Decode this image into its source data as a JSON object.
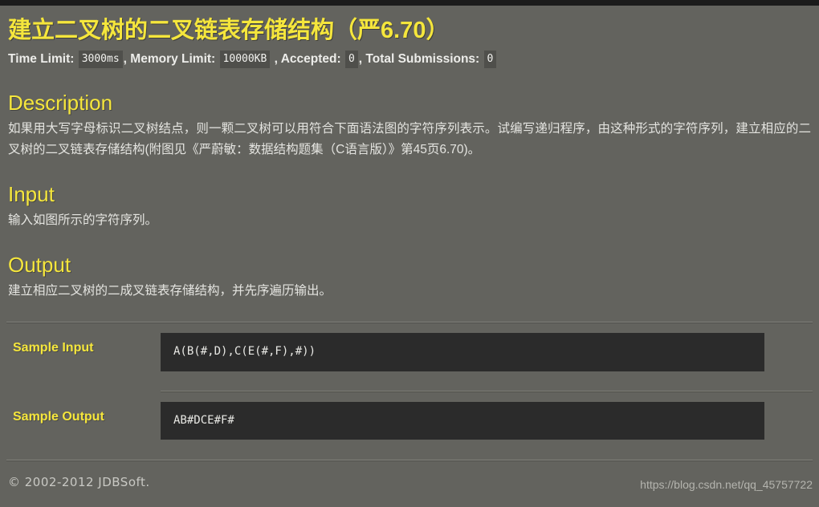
{
  "page": {
    "background_color": "#63635e",
    "accent_color": "#f5e63c",
    "code_background_color": "#2b2b2b"
  },
  "problem": {
    "title": "建立二叉树的二叉链表存储结构（严6.70）",
    "limits": {
      "time_limit_label": "Time Limit:",
      "time_limit_value": "3000ms",
      "comma_1": ",",
      "memory_limit_label": "Memory Limit:",
      "memory_limit_value": "10000KB",
      "comma_2": ",",
      "accepted_label": "Accepted:",
      "accepted_value": "0",
      "comma_3": ",",
      "total_submissions_label": "Total Submissions:",
      "total_submissions_value": "0"
    }
  },
  "sections": {
    "description": {
      "heading": "Description",
      "body": "如果用大写字母标识二叉树结点，则一颗二叉树可以用符合下面语法图的字符序列表示。试编写递归程序，由这种形式的字符序列，建立相应的二叉树的二叉链表存储结构(附图见《严蔚敏：数据结构题集（C语言版）》第45页6.70)。"
    },
    "input": {
      "heading": "Input",
      "body": "输入如图所示的字符序列。"
    },
    "output": {
      "heading": "Output",
      "body": "建立相应二叉树的二成叉链表存储结构，并先序遍历输出。"
    }
  },
  "samples": [
    {
      "label": "Sample Input",
      "content": "A(B(#,D),C(E(#,F),#))"
    },
    {
      "label": "Sample Output",
      "content": "AB#DCE#F#"
    }
  ],
  "footer": {
    "copyright": "© 2002-2012  JDBSoft.",
    "watermark": "https://blog.csdn.net/qq_45757722"
  }
}
